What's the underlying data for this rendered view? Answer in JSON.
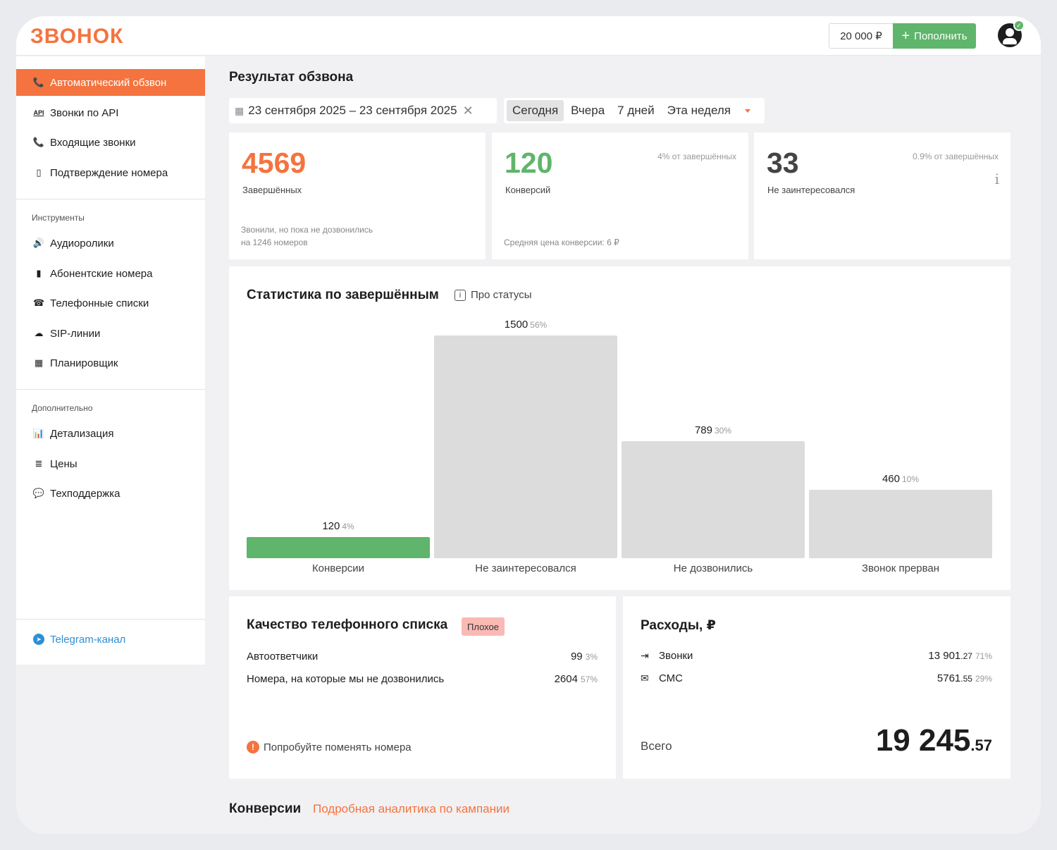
{
  "app": {
    "logo": "ЗВОНОК"
  },
  "header": {
    "balance": "20 000 ₽",
    "topup_label": "Пополнить"
  },
  "sidebar": {
    "main": [
      {
        "label": "Автоматический обзвон",
        "icon": "phone-icon"
      },
      {
        "label": "Звонки по API",
        "icon": "api-icon"
      },
      {
        "label": "Входящие звонки",
        "icon": "incoming-call-icon"
      },
      {
        "label": "Подтверждение номера",
        "icon": "phone-check-icon"
      }
    ],
    "tools_group": "Инструменты",
    "tools": [
      {
        "label": "Аудиоролики",
        "icon": "speaker-icon"
      },
      {
        "label": "Абонентские номера",
        "icon": "sim-icon"
      },
      {
        "label": "Телефонные списки",
        "icon": "contacts-icon"
      },
      {
        "label": "SIP-линии",
        "icon": "sip-cloud-icon"
      },
      {
        "label": "Планировщик",
        "icon": "calendar-icon"
      }
    ],
    "extra_group": "Дополнительно",
    "extra": [
      {
        "label": "Детализация",
        "icon": "stats-icon"
      },
      {
        "label": "Цены",
        "icon": "coins-icon"
      },
      {
        "label": "Техподдержка",
        "icon": "support-icon"
      }
    ],
    "telegram": "Telegram-канал"
  },
  "main": {
    "title": "Результат обзвона",
    "date_range": "23 сентября 2025 – 23 сентября 2025",
    "quick_ranges": [
      "Сегодня",
      "Вчера",
      "7 дней",
      "Эта неделя"
    ],
    "cards": [
      {
        "value": "4569",
        "label": "Завершённых",
        "note": "",
        "sub1": "Звонили, но пока не дозвонились",
        "sub2": "на 1246 номеров"
      },
      {
        "value": "120",
        "label": "Конверсий",
        "note": "4% от завершённых",
        "sub1": "Средняя цена конверсии: 6 ₽"
      },
      {
        "value": "33",
        "label": "Не заинтересовался",
        "note": "0.9% от завершённых"
      }
    ],
    "stats": {
      "title": "Статистика по завершённым",
      "about": "Про статусы"
    },
    "quality": {
      "title": "Качество телефонного списка",
      "badge": "Плохое",
      "rows": [
        {
          "label": "Автоответчики",
          "value": "99",
          "pct": "3%"
        },
        {
          "label": "Номера, на которые мы не дозвонились",
          "value": "2604",
          "pct": "57%"
        }
      ],
      "warning": "Попробуйте поменять номера"
    },
    "expenses": {
      "title": "Расходы, ₽",
      "rows": [
        {
          "label": "Звонки",
          "int": "13 901",
          "dec": ".27",
          "pct": "71%"
        },
        {
          "label": "СМС",
          "int": "5761",
          "dec": ".55",
          "pct": "29%"
        }
      ],
      "total_label": "Всего",
      "total_int": "19 245",
      "total_dec": ".57"
    },
    "footer": {
      "title": "Конверсии",
      "link": "Подробная аналитика по кампании"
    }
  },
  "chart_data": {
    "type": "bar",
    "categories": [
      "Конверсии",
      "Не заинтересовался",
      "Не дозвонились",
      "Звонок прерван"
    ],
    "values": [
      120,
      1500,
      789,
      460
    ],
    "percent_labels": [
      "4%",
      "56%",
      "30%",
      "10%"
    ],
    "colors": [
      "#5fb56b",
      "#dcdcdc",
      "#dcdcdc",
      "#dcdcdc"
    ],
    "title": "Статистика по завершённым",
    "ylim": [
      0,
      1500
    ],
    "grid": false
  },
  "colors": {
    "accent": "#f4733f",
    "success": "#5fb56b",
    "link": "#2b8fd6"
  }
}
